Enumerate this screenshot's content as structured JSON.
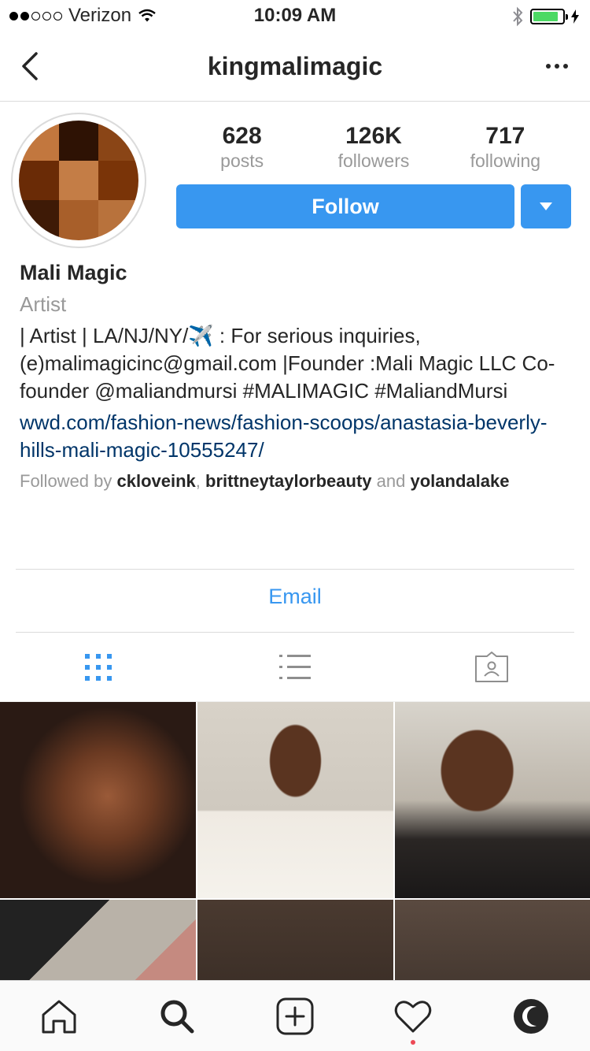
{
  "status_bar": {
    "carrier": "Verizon",
    "time": "10:09 AM",
    "signal_bars_filled": 2,
    "signal_bars_total": 5,
    "battery_level": 0.85
  },
  "header": {
    "username": "kingmalimagic"
  },
  "profile": {
    "stats": [
      {
        "count": "628",
        "label": "posts"
      },
      {
        "count": "126K",
        "label": "followers"
      },
      {
        "count": "717",
        "label": "following"
      }
    ],
    "follow_label": "Follow",
    "full_name": "Mali Magic",
    "category": "Artist",
    "bio": "| Artist | LA/NJ/NY/✈️ : For serious inquiries, (e)malimagicinc@gmail.com |Founder :Mali Magic LLC Co-founder @maliandmursi #MALIMAGIC #MaliandMursi",
    "link": "wwd.com/fashion-news/fashion-scoops/anastasia-beverly-hills-mali-magic-10555247/",
    "followed_by_prefix": "Followed by",
    "followed_by_users": [
      "ckloveink",
      "brittneytaylorbeauty",
      "yolandalake"
    ],
    "followed_by_and": "and",
    "email_label": "Email"
  },
  "colors": {
    "accent": "#3897f0",
    "link": "#003569",
    "muted": "#999999",
    "divider": "#dbdbdb",
    "notification": "#ed4956"
  },
  "icons": {
    "nav_back": "chevron-left-icon",
    "nav_more": "more-horizontal-icon",
    "tab_grid": "grid-view-icon",
    "tab_list": "list-view-icon",
    "tab_tagged": "tagged-photos-icon",
    "bar_home": "home-icon",
    "bar_search": "search-icon",
    "bar_add": "add-post-icon",
    "bar_activity": "heart-icon",
    "bar_profile": "profile-icon"
  }
}
